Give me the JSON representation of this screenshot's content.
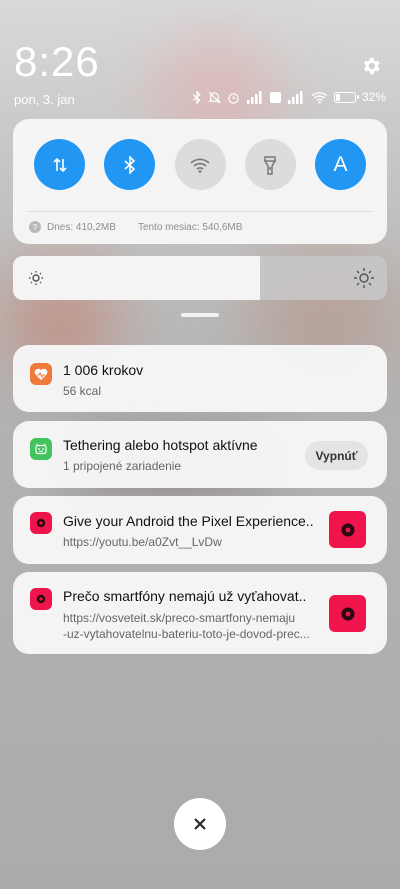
{
  "status": {
    "time": "8:26",
    "date": "pon, 3. jan",
    "battery_percent": "32%",
    "battery_level": 0.32
  },
  "quick_settings": {
    "tiles": [
      {
        "name": "mobile-data",
        "state": "on"
      },
      {
        "name": "bluetooth",
        "state": "on"
      },
      {
        "name": "wifi",
        "state": "off"
      },
      {
        "name": "flashlight",
        "state": "off"
      },
      {
        "name": "auto-brightness",
        "state": "on",
        "label": "A"
      }
    ],
    "data_today": "Dnes: 410,2MB",
    "data_month": "Tento mesiac: 540,6MB"
  },
  "brightness": {
    "level": 0.66
  },
  "notifications": [
    {
      "app": "health",
      "title": "1 006 krokov",
      "text": "56 kcal",
      "icon_color": "#f07a3c"
    },
    {
      "app": "tethering",
      "title": "Tethering alebo hotspot aktívne",
      "text": "1 pripojené zariadenie",
      "action": "Vypnúť",
      "icon_color": "#43c35e"
    },
    {
      "app": "news",
      "title": "Give your Android the Pixel Experience..",
      "text": "https://youtu.be/a0Zvt__LvDw",
      "icon_color": "#f0144c"
    },
    {
      "app": "news",
      "title": "Prečo smartfóny nemajú už vyťahovat..",
      "text_line1": "https://vosveteit.sk/preco-smartfony-nemaju",
      "text_line2": "-uz-vytahovatelnu-bateriu-toto-je-dovod-prec...",
      "icon_color": "#f0144c"
    }
  ],
  "colors": {
    "accent": "#2196f3",
    "tile_off": "#dcdcdc",
    "news_red": "#f0144c"
  }
}
